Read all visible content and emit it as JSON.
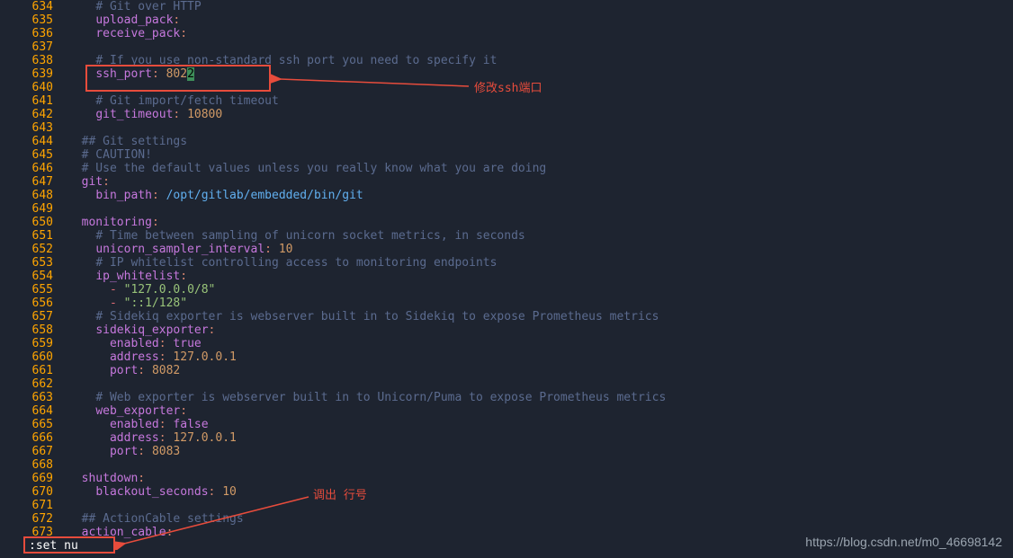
{
  "lines": [
    {
      "num": "634",
      "parts": [
        {
          "t": "    ",
          "c": ""
        },
        {
          "t": "# Git over HTTP",
          "c": "comment"
        }
      ]
    },
    {
      "num": "635",
      "parts": [
        {
          "t": "    ",
          "c": ""
        },
        {
          "t": "upload_pack",
          "c": "key"
        },
        {
          "t": ":",
          "c": "colon"
        }
      ]
    },
    {
      "num": "636",
      "parts": [
        {
          "t": "    ",
          "c": ""
        },
        {
          "t": "receive_pack",
          "c": "key"
        },
        {
          "t": ":",
          "c": "colon"
        }
      ]
    },
    {
      "num": "637",
      "parts": []
    },
    {
      "num": "638",
      "parts": [
        {
          "t": "    ",
          "c": ""
        },
        {
          "t": "# If you use non-standard ssh port you need to specify it",
          "c": "comment"
        }
      ]
    },
    {
      "num": "639",
      "parts": [
        {
          "t": "    ",
          "c": ""
        },
        {
          "t": "ssh_port",
          "c": "key"
        },
        {
          "t": ":",
          "c": "colon"
        },
        {
          "t": " ",
          "c": ""
        },
        {
          "t": "802",
          "c": "num"
        },
        {
          "t": "2",
          "c": "cursor-hl"
        }
      ]
    },
    {
      "num": "640",
      "parts": []
    },
    {
      "num": "641",
      "parts": [
        {
          "t": "    ",
          "c": ""
        },
        {
          "t": "# Git import/fetch timeout",
          "c": "comment"
        }
      ]
    },
    {
      "num": "642",
      "parts": [
        {
          "t": "    ",
          "c": ""
        },
        {
          "t": "git_timeout",
          "c": "key"
        },
        {
          "t": ":",
          "c": "colon"
        },
        {
          "t": " ",
          "c": ""
        },
        {
          "t": "10800",
          "c": "num"
        }
      ]
    },
    {
      "num": "643",
      "parts": []
    },
    {
      "num": "644",
      "parts": [
        {
          "t": "  ",
          "c": ""
        },
        {
          "t": "## Git settings",
          "c": "comment"
        }
      ]
    },
    {
      "num": "645",
      "parts": [
        {
          "t": "  ",
          "c": ""
        },
        {
          "t": "# CAUTION!",
          "c": "comment"
        }
      ]
    },
    {
      "num": "646",
      "parts": [
        {
          "t": "  ",
          "c": ""
        },
        {
          "t": "# Use the default values unless you really know what you are doing",
          "c": "comment"
        }
      ]
    },
    {
      "num": "647",
      "parts": [
        {
          "t": "  ",
          "c": ""
        },
        {
          "t": "git",
          "c": "key"
        },
        {
          "t": ":",
          "c": "colon"
        }
      ]
    },
    {
      "num": "648",
      "parts": [
        {
          "t": "    ",
          "c": ""
        },
        {
          "t": "bin_path",
          "c": "key"
        },
        {
          "t": ":",
          "c": "colon"
        },
        {
          "t": " ",
          "c": ""
        },
        {
          "t": "/opt/gitlab/embedded/bin/git",
          "c": "path"
        }
      ]
    },
    {
      "num": "649",
      "parts": []
    },
    {
      "num": "650",
      "parts": [
        {
          "t": "  ",
          "c": ""
        },
        {
          "t": "monitoring",
          "c": "key"
        },
        {
          "t": ":",
          "c": "colon"
        }
      ]
    },
    {
      "num": "651",
      "parts": [
        {
          "t": "    ",
          "c": ""
        },
        {
          "t": "# Time between sampling of unicorn socket metrics, in seconds",
          "c": "comment"
        }
      ]
    },
    {
      "num": "652",
      "parts": [
        {
          "t": "    ",
          "c": ""
        },
        {
          "t": "unicorn_sampler_interval",
          "c": "key"
        },
        {
          "t": ":",
          "c": "colon"
        },
        {
          "t": " ",
          "c": ""
        },
        {
          "t": "10",
          "c": "num"
        }
      ]
    },
    {
      "num": "653",
      "parts": [
        {
          "t": "    ",
          "c": ""
        },
        {
          "t": "# IP whitelist controlling access to monitoring endpoints",
          "c": "comment"
        }
      ]
    },
    {
      "num": "654",
      "parts": [
        {
          "t": "    ",
          "c": ""
        },
        {
          "t": "ip_whitelist",
          "c": "key"
        },
        {
          "t": ":",
          "c": "colon"
        }
      ]
    },
    {
      "num": "655",
      "parts": [
        {
          "t": "      ",
          "c": ""
        },
        {
          "t": "-",
          "c": "dash"
        },
        {
          "t": " ",
          "c": ""
        },
        {
          "t": "\"127.0.0.0/8\"",
          "c": "str"
        }
      ]
    },
    {
      "num": "656",
      "parts": [
        {
          "t": "      ",
          "c": ""
        },
        {
          "t": "-",
          "c": "dash"
        },
        {
          "t": " ",
          "c": ""
        },
        {
          "t": "\"::1/128\"",
          "c": "str"
        }
      ]
    },
    {
      "num": "657",
      "parts": [
        {
          "t": "    ",
          "c": ""
        },
        {
          "t": "# Sidekiq exporter is webserver built in to Sidekiq to expose Prometheus metrics",
          "c": "comment"
        }
      ]
    },
    {
      "num": "658",
      "parts": [
        {
          "t": "    ",
          "c": ""
        },
        {
          "t": "sidekiq_exporter",
          "c": "key"
        },
        {
          "t": ":",
          "c": "colon"
        }
      ]
    },
    {
      "num": "659",
      "parts": [
        {
          "t": "      ",
          "c": ""
        },
        {
          "t": "enabled",
          "c": "key"
        },
        {
          "t": ":",
          "c": "colon"
        },
        {
          "t": " ",
          "c": ""
        },
        {
          "t": "true",
          "c": "bool"
        }
      ]
    },
    {
      "num": "660",
      "parts": [
        {
          "t": "      ",
          "c": ""
        },
        {
          "t": "address",
          "c": "key"
        },
        {
          "t": ":",
          "c": "colon"
        },
        {
          "t": " ",
          "c": ""
        },
        {
          "t": "127.0.0.1",
          "c": "num"
        }
      ]
    },
    {
      "num": "661",
      "parts": [
        {
          "t": "      ",
          "c": ""
        },
        {
          "t": "port",
          "c": "key"
        },
        {
          "t": ":",
          "c": "colon"
        },
        {
          "t": " ",
          "c": ""
        },
        {
          "t": "8082",
          "c": "num"
        }
      ]
    },
    {
      "num": "662",
      "parts": []
    },
    {
      "num": "663",
      "parts": [
        {
          "t": "    ",
          "c": ""
        },
        {
          "t": "# Web exporter is webserver built in to Unicorn/Puma to expose Prometheus metrics",
          "c": "comment"
        }
      ]
    },
    {
      "num": "664",
      "parts": [
        {
          "t": "    ",
          "c": ""
        },
        {
          "t": "web_exporter",
          "c": "key"
        },
        {
          "t": ":",
          "c": "colon"
        }
      ]
    },
    {
      "num": "665",
      "parts": [
        {
          "t": "      ",
          "c": ""
        },
        {
          "t": "enabled",
          "c": "key"
        },
        {
          "t": ":",
          "c": "colon"
        },
        {
          "t": " ",
          "c": ""
        },
        {
          "t": "false",
          "c": "bool"
        }
      ]
    },
    {
      "num": "666",
      "parts": [
        {
          "t": "      ",
          "c": ""
        },
        {
          "t": "address",
          "c": "key"
        },
        {
          "t": ":",
          "c": "colon"
        },
        {
          "t": " ",
          "c": ""
        },
        {
          "t": "127.0.0.1",
          "c": "num"
        }
      ]
    },
    {
      "num": "667",
      "parts": [
        {
          "t": "      ",
          "c": ""
        },
        {
          "t": "port",
          "c": "key"
        },
        {
          "t": ":",
          "c": "colon"
        },
        {
          "t": " ",
          "c": ""
        },
        {
          "t": "8083",
          "c": "num"
        }
      ]
    },
    {
      "num": "668",
      "parts": []
    },
    {
      "num": "669",
      "parts": [
        {
          "t": "  ",
          "c": ""
        },
        {
          "t": "shutdown",
          "c": "key"
        },
        {
          "t": ":",
          "c": "colon"
        }
      ]
    },
    {
      "num": "670",
      "parts": [
        {
          "t": "    ",
          "c": ""
        },
        {
          "t": "blackout_seconds",
          "c": "key"
        },
        {
          "t": ":",
          "c": "colon"
        },
        {
          "t": " ",
          "c": ""
        },
        {
          "t": "10",
          "c": "num"
        }
      ]
    },
    {
      "num": "671",
      "parts": []
    },
    {
      "num": "672",
      "parts": [
        {
          "t": "  ",
          "c": ""
        },
        {
          "t": "## ActionCable settings",
          "c": "comment"
        }
      ]
    },
    {
      "num": "673",
      "parts": [
        {
          "t": "  ",
          "c": ""
        },
        {
          "t": "action_cable",
          "c": "key"
        },
        {
          "t": ":",
          "c": "colon"
        }
      ]
    }
  ],
  "annotations": {
    "label1": "修改ssh端口",
    "label2": "调出 行号"
  },
  "cmdline": ":set nu",
  "watermark": "https://blog.csdn.net/m0_46698142"
}
